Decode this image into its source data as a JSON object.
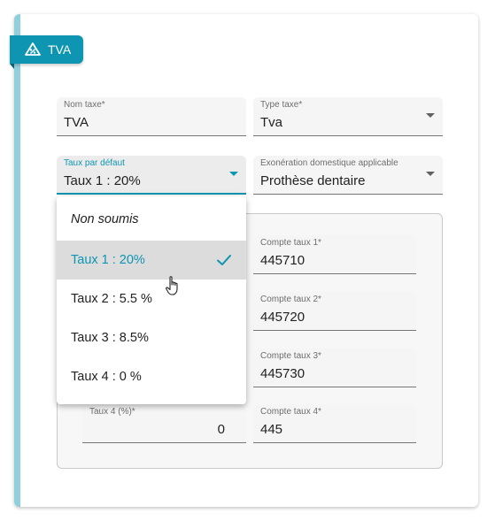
{
  "tab": {
    "label": "TVA"
  },
  "fields": {
    "nom_taxe": {
      "label": "Nom taxe*",
      "value": "TVA"
    },
    "type_taxe": {
      "label": "Type taxe*",
      "value": "Tva"
    },
    "taux_defaut": {
      "label": "Taux par défaut",
      "value": "Taux 1 : 20%"
    },
    "exoneration": {
      "label": "Exonération domestique applicable",
      "value": "Prothèse dentaire"
    },
    "compte1": {
      "label": "Compte taux 1*",
      "value": "445710"
    },
    "compte2": {
      "label": "Compte taux 2*",
      "value": "445720"
    },
    "compte3": {
      "label": "Compte taux 3*",
      "value": "445730"
    },
    "taux4": {
      "label": "Taux 4 (%)*",
      "value": "0"
    },
    "compte4": {
      "label": "Compte taux 4*",
      "value": "445"
    }
  },
  "dropdown": {
    "options": [
      "Non soumis",
      "Taux 1 : 20%",
      "Taux 2 : 5.5 %",
      "Taux 3 : 8.5%",
      "Taux 4 : 0 %"
    ],
    "selected": "Taux 1 : 20%"
  },
  "colors": {
    "accent": "#0e95b2",
    "stripe": "#8fd0de"
  },
  "icons": {
    "tab": "tax-percent-icon",
    "check": "check-icon",
    "cursor": "hand-pointer-icon"
  }
}
